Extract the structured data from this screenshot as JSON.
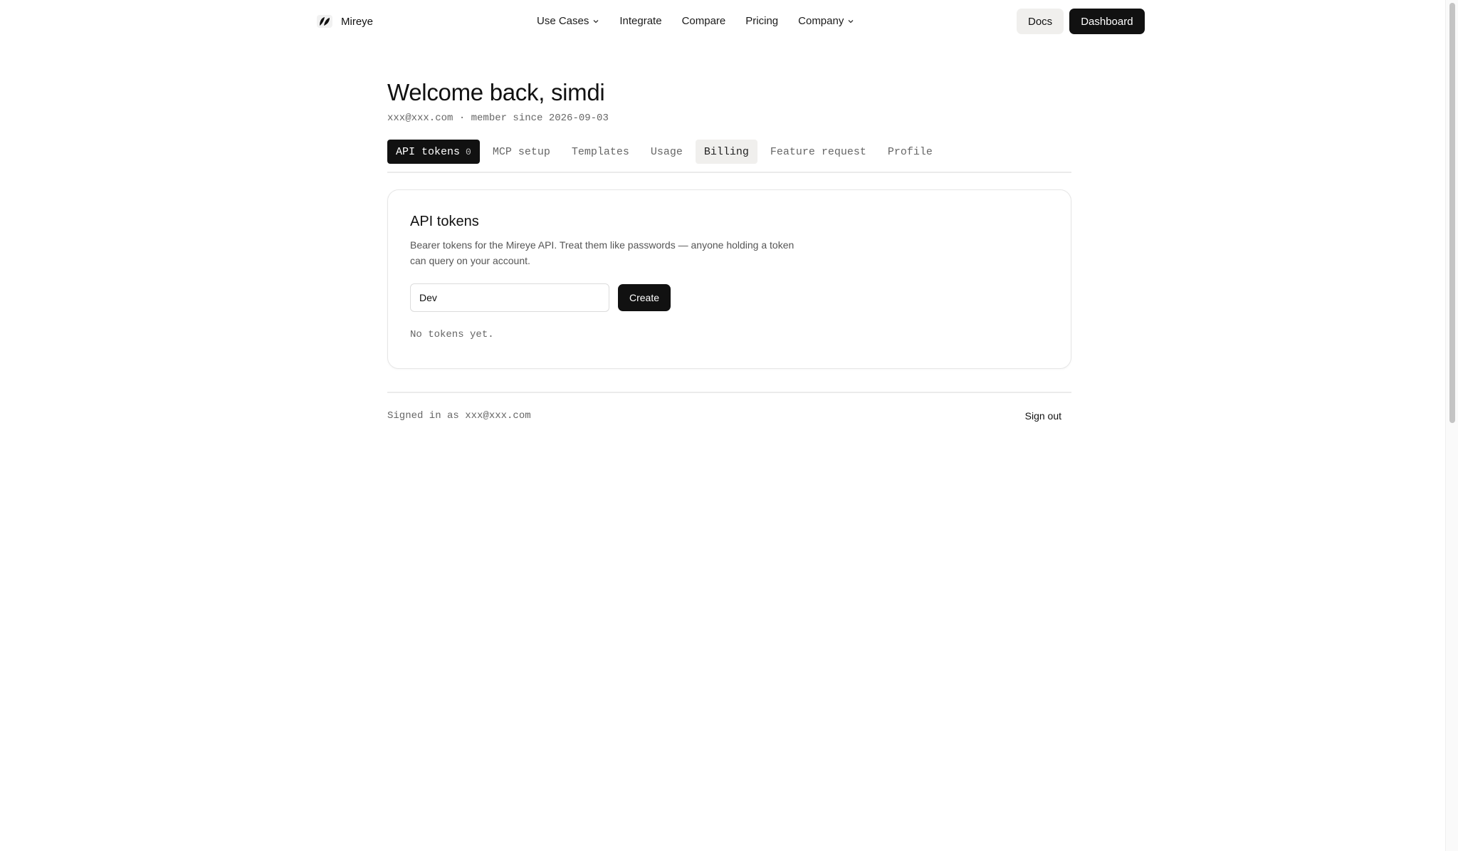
{
  "brand": {
    "name": "Mireye",
    "logo_icon": "leaf-logo-icon"
  },
  "nav": {
    "links": [
      {
        "label": "Use Cases",
        "has_dropdown": true
      },
      {
        "label": "Integrate",
        "has_dropdown": false
      },
      {
        "label": "Compare",
        "has_dropdown": false
      },
      {
        "label": "Pricing",
        "has_dropdown": false
      },
      {
        "label": "Company",
        "has_dropdown": true
      }
    ],
    "docs_label": "Docs",
    "dashboard_label": "Dashboard"
  },
  "header": {
    "welcome": "Welcome back, simdi",
    "meta": "xxx@xxx.com · member since 2026-09-03"
  },
  "tabs": [
    {
      "label": "API tokens",
      "count": "0",
      "state": "active"
    },
    {
      "label": "MCP setup",
      "state": "default"
    },
    {
      "label": "Templates",
      "state": "default"
    },
    {
      "label": "Usage",
      "state": "default"
    },
    {
      "label": "Billing",
      "state": "hover"
    },
    {
      "label": "Feature request",
      "state": "default"
    },
    {
      "label": "Profile",
      "state": "default"
    }
  ],
  "card": {
    "title": "API tokens",
    "description": "Bearer tokens for the Mireye API. Treat them like passwords — anyone holding a token can query on your account.",
    "input_value": "Dev",
    "create_label": "Create",
    "empty_text": "No tokens yet."
  },
  "footer": {
    "signed_in": "Signed in as xxx@xxx.com",
    "signout_label": "Sign out"
  },
  "colors": {
    "primary": "#111111",
    "muted_text": "#666666",
    "hover_tab_bg": "#f0efed",
    "border": "#e6e6e6"
  }
}
